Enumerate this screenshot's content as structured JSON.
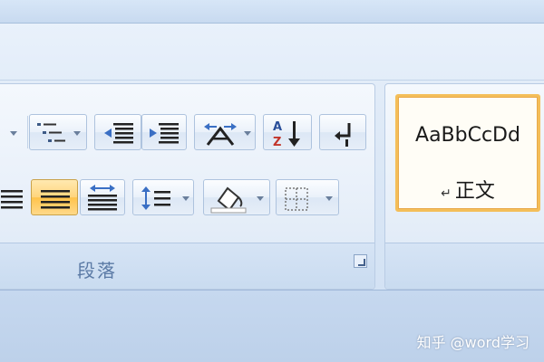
{
  "ribbon": {
    "paragraph_group": {
      "title": "段落"
    },
    "styles_group": {
      "style_preview": "AaBbCcDd",
      "style_name": "正文",
      "paragraph_mark": "↵"
    }
  },
  "icons": [
    "multilevel-list-icon",
    "decrease-indent-icon",
    "increase-indent-icon",
    "text-direction-icon",
    "sort-icon",
    "show-hide-paragraph-marks-icon",
    "align-right-icon",
    "justify-icon",
    "distributed-icon",
    "line-spacing-icon",
    "shading-icon",
    "borders-icon",
    "dialog-launcher-icon"
  ],
  "colors": {
    "ribbon_bg": "#dfeaf7",
    "group_border": "#b9cce4",
    "active_button": "#ffc34b",
    "style_border": "#f4be59",
    "group_label_text": "#5b7aa5"
  },
  "watermark": "知乎 @word学习"
}
